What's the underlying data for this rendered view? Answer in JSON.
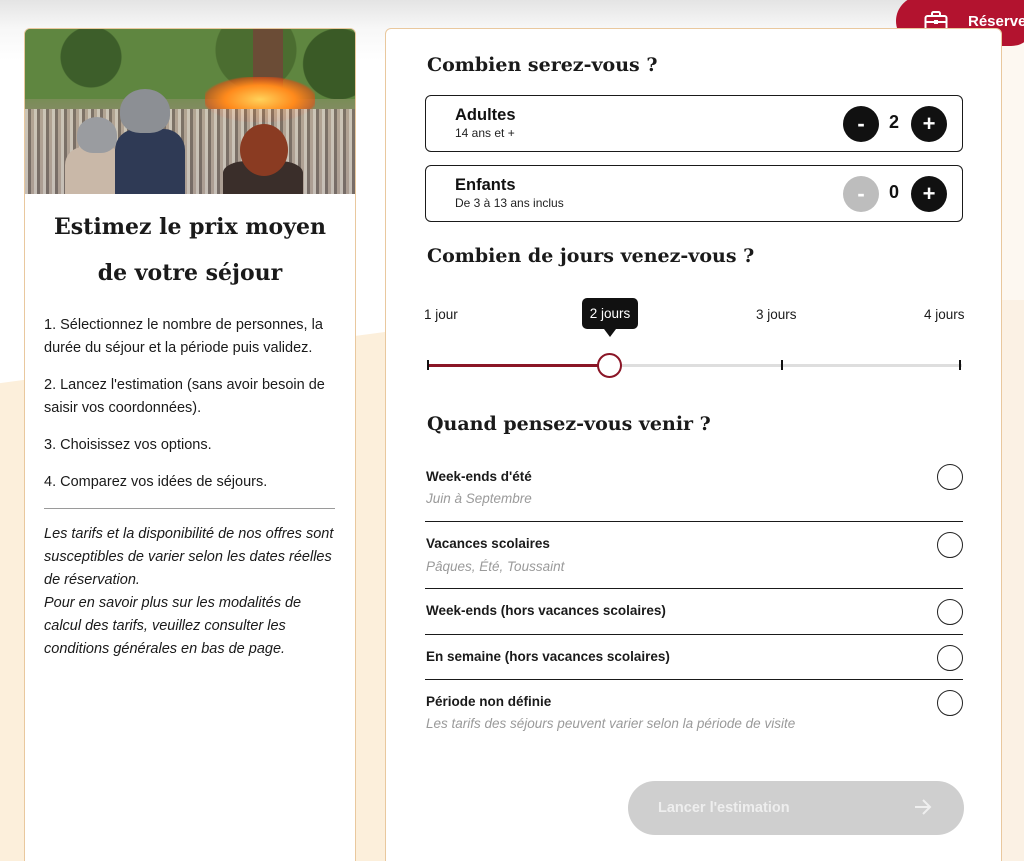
{
  "header": {
    "reserve_label": "Réserve"
  },
  "left": {
    "title": "Estimez le prix moyen de votre séjour",
    "steps": [
      "1. Sélectionnez le nombre de personnes, la durée du séjour et la période puis validez.",
      "2. Lancez l'estimation (sans avoir besoin de saisir vos coordonnées).",
      "3. Choisissez vos options.",
      "4. Comparez vos idées de séjours."
    ],
    "disclaimer_line1": "Les tarifs et la disponibilité de nos offres sont susceptibles de varier selon les dates réelles de réservation.",
    "disclaimer_line2": "Pour en savoir plus sur les modalités de calcul des tarifs, veuillez consulter les conditions générales en bas de page."
  },
  "people": {
    "title": "Combien serez-vous ?",
    "adults": {
      "label": "Adultes",
      "sub": "14 ans et +",
      "count": "2",
      "minus": "-",
      "plus": "+"
    },
    "children": {
      "label": "Enfants",
      "sub": "De 3 à 13 ans inclus",
      "count": "0",
      "minus": "-",
      "plus": "+"
    }
  },
  "days": {
    "title": "Combien de jours venez-vous ?",
    "options": [
      "1 jour",
      "2 jours",
      "3 jours",
      "4 jours"
    ],
    "selected_label": "2 jours",
    "selected_value": 2
  },
  "period": {
    "title": "Quand pensez-vous venir ?",
    "options": [
      {
        "label": "Week-ends d'été",
        "hint": "Juin à Septembre"
      },
      {
        "label": "Vacances scolaires",
        "hint": "Pâques, Été, Toussaint"
      },
      {
        "label": "Week-ends (hors vacances scolaires)",
        "hint": ""
      },
      {
        "label": "En semaine (hors vacances scolaires)",
        "hint": ""
      },
      {
        "label": "Période non définie",
        "hint": "Les tarifs des séjours peuvent varier selon la période de visite"
      }
    ]
  },
  "actions": {
    "launch_label": "Lancer l'estimation"
  },
  "colors": {
    "brand": "#b3132f",
    "slider": "#8a1526",
    "border": "#e9c89e",
    "cream": "#fcefdb"
  }
}
